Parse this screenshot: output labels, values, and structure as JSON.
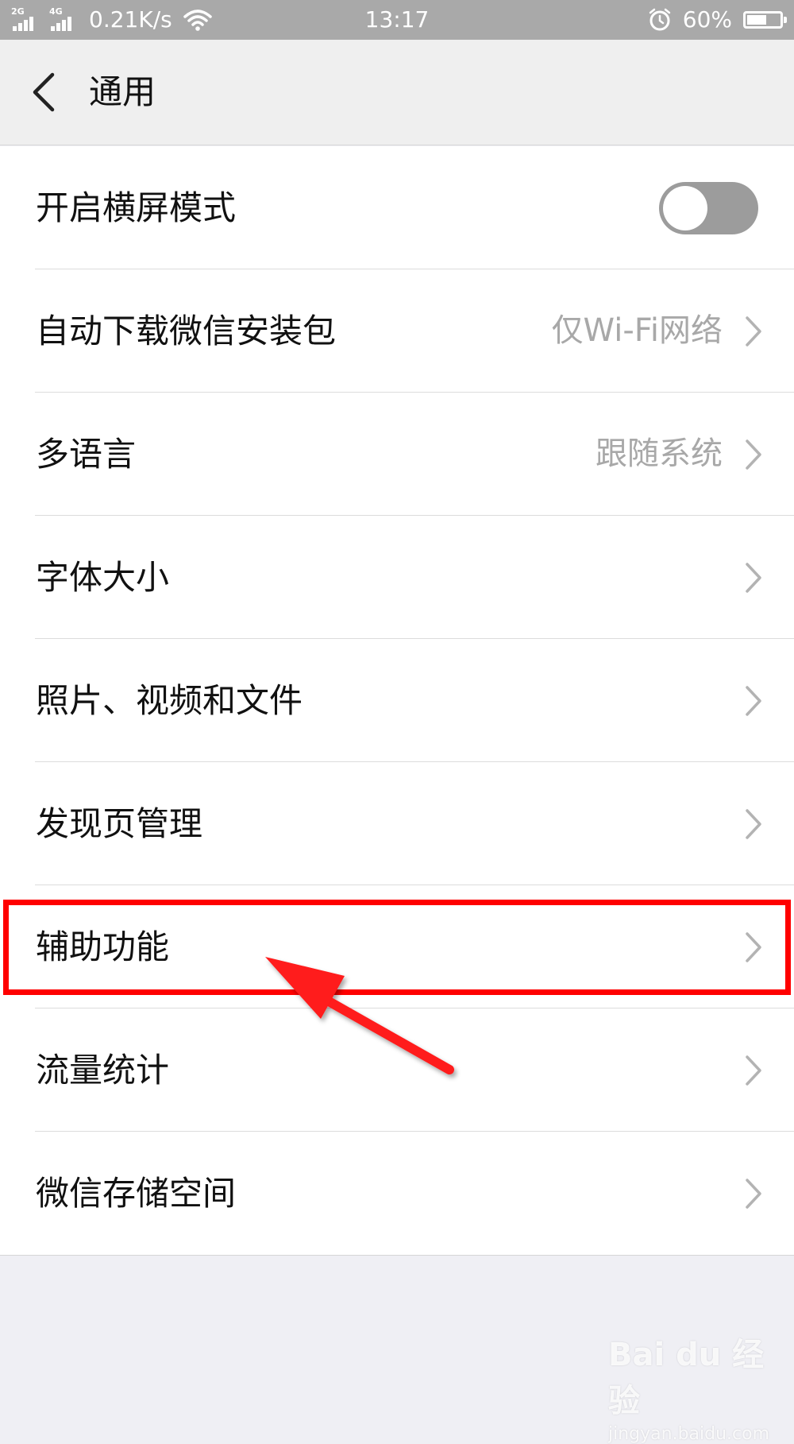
{
  "status_bar": {
    "signal1_tag": "2G",
    "signal2_tag": "4G",
    "speed": "0.21K/s",
    "time": "13:17",
    "battery": "60%",
    "battery_level": 0.6
  },
  "header": {
    "title": "通用"
  },
  "settings": {
    "items": [
      {
        "label": "开启横屏模式",
        "control": "toggle",
        "toggle_on": false
      },
      {
        "label": "自动下载微信安装包",
        "value": "仅Wi-Fi网络"
      },
      {
        "label": "多语言",
        "value": "跟随系统"
      },
      {
        "label": "字体大小"
      },
      {
        "label": "照片、视频和文件"
      },
      {
        "label": "发现页管理"
      },
      {
        "label": "辅助功能"
      },
      {
        "label": "流量统计"
      },
      {
        "label": "微信存储空间"
      }
    ]
  },
  "annotation": {
    "color": "#ff0000",
    "target": "辅助功能"
  },
  "watermark": {
    "brand": "Bai du 经验",
    "site": "jingyan.baidu.com"
  },
  "colors": {
    "status_bar": "#a9a9a9",
    "header_bg": "#efefef",
    "list_bg": "#ffffff",
    "value_text": "#a8a8a8",
    "toggle_off": "#9c9c9c"
  }
}
